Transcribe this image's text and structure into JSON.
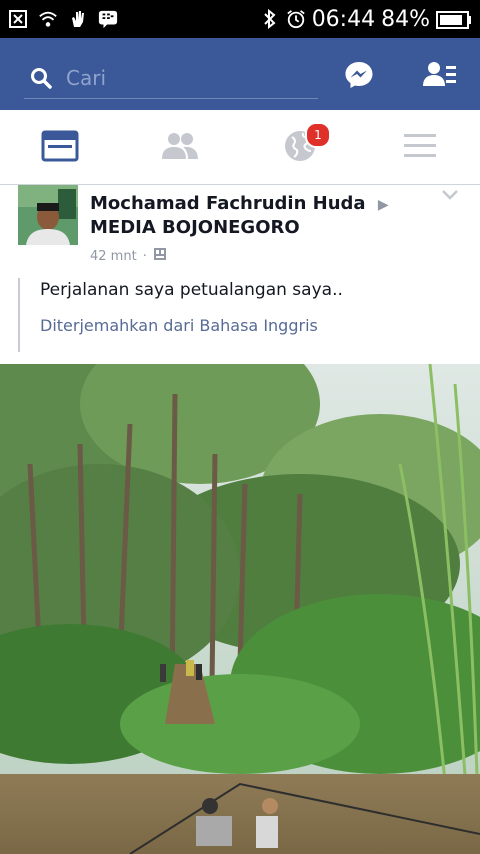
{
  "status_bar": {
    "time": "06:44",
    "battery": "84%",
    "icons": [
      "close-box-icon",
      "wifi-icon",
      "hand-icon",
      "bbm-icon",
      "bluetooth-icon",
      "alarm-icon",
      "battery-icon"
    ]
  },
  "header": {
    "search_placeholder": "Cari",
    "icons": [
      "search-icon",
      "messenger-icon",
      "friend-requests-icon"
    ],
    "brand_color": "#3b5998"
  },
  "tabs": {
    "items": [
      "news-feed",
      "friends",
      "notifications",
      "menu"
    ],
    "notification_badge": "1"
  },
  "post": {
    "author": "Mochamad Fachrudin Huda",
    "page": "MEDIA BOJONEGORO",
    "time": "42 mnt",
    "separator": "·",
    "text": "Perjalanan saya petualangan saya..",
    "translation": "Diterjemahkan dari Bahasa Inggris"
  }
}
